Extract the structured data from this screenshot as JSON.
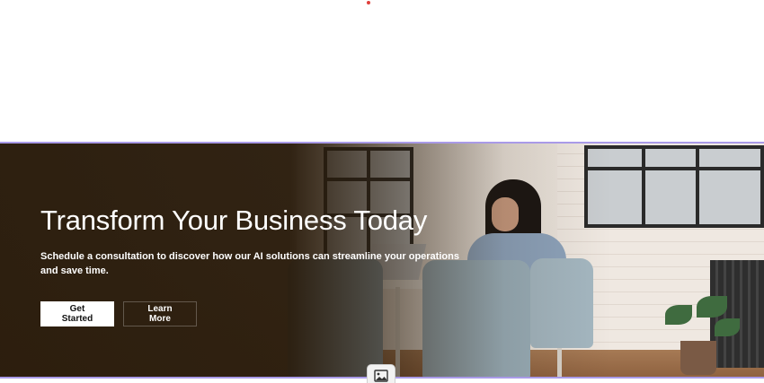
{
  "hero": {
    "title": "Transform Your Business Today",
    "subtitle": "Schedule a consultation to discover how our AI solutions can streamline your operations and save time.",
    "primary_button": "Get Started",
    "secondary_button": "Learn More"
  },
  "icons": {
    "image_placeholder": "image-icon"
  },
  "colors": {
    "hero_border": "#a99ae8",
    "overlay": "#281a0a",
    "primary_button_bg": "#ffffff",
    "accent_dot": "#e0403c"
  }
}
